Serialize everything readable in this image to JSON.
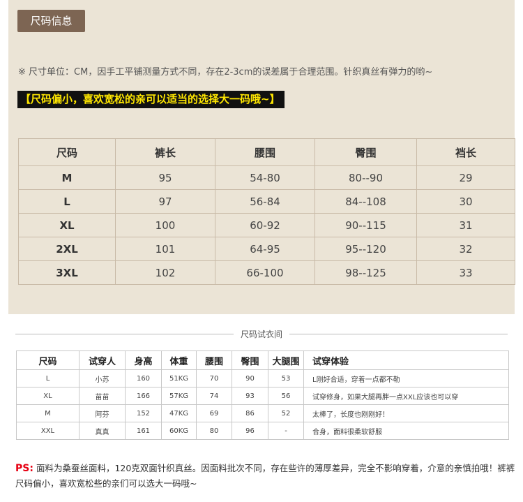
{
  "section_tag": "尺码信息",
  "size_note": "※ 尺寸单位：CM，因手工平铺测量方式不同，存在2-3cm的误差属于合理范围。针织真丝有弹力的哟~",
  "banner": "【尺码偏小，喜欢宽松的亲可以适当的选择大一码哦~】",
  "size_table": {
    "headers": [
      "尺码",
      "裤长",
      "腰围",
      "臀围",
      "裆长"
    ],
    "rows": [
      [
        "M",
        "95",
        "54-80",
        "80--90",
        "29"
      ],
      [
        "L",
        "97",
        "56-84",
        "84--108",
        "30"
      ],
      [
        "XL",
        "100",
        "60-92",
        "90--115",
        "31"
      ],
      [
        "2XL",
        "101",
        "64-95",
        "95--120",
        "32"
      ],
      [
        "3XL",
        "102",
        "66-100",
        "98--125",
        "33"
      ]
    ]
  },
  "fit_title": "尺码试衣间",
  "fit_table": {
    "headers": [
      "尺码",
      "试穿人",
      "身高",
      "体重",
      "腰围",
      "臀围",
      "大腿围",
      "试穿体验"
    ],
    "rows": [
      [
        "L",
        "小苏",
        "160",
        "51KG",
        "70",
        "90",
        "53",
        "L刚好合适，穿着一点都不勒"
      ],
      [
        "XL",
        "苗苗",
        "166",
        "57KG",
        "74",
        "93",
        "56",
        "试穿修身，如果大腿再胖一点XXL应该也可以穿"
      ],
      [
        "M",
        "阿芬",
        "152",
        "47KG",
        "69",
        "86",
        "52",
        "太棒了，长度也刚刚好！"
      ],
      [
        "XXL",
        "真真",
        "161",
        "60KG",
        "80",
        "96",
        "-",
        "合身，面料很柔软舒服"
      ]
    ]
  },
  "ps_label": "PS:",
  "ps_text": "面料为桑蚕丝面料，120克双面针织真丝。因面料批次不同，存在些许的薄厚差异，完全不影响穿着，介意的亲慎拍哦！裤裤尺码偏小，喜欢宽松些的亲们可以选大一码哦~"
}
